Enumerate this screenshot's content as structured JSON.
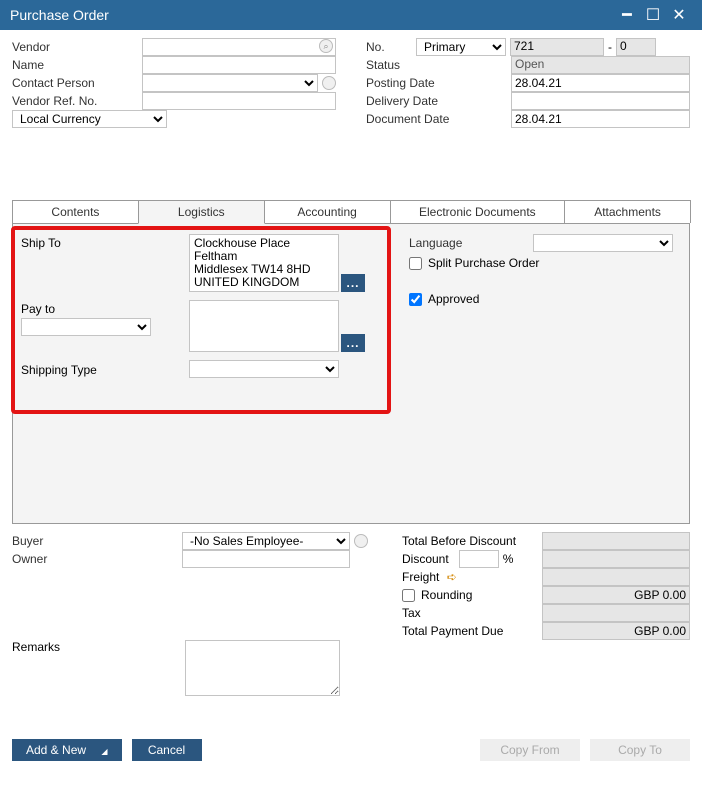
{
  "window": {
    "title": "Purchase Order"
  },
  "header": {
    "left": {
      "vendor_label": "Vendor",
      "vendor_value": "",
      "name_label": "Name",
      "name_value": "",
      "contact_label": "Contact Person",
      "contact_value": "",
      "vendorref_label": "Vendor Ref. No.",
      "vendorref_value": "",
      "currency_value": "Local Currency"
    },
    "right": {
      "no_label": "No.",
      "no_series": "Primary",
      "no_value": "721",
      "no_suffix": "0",
      "status_label": "Status",
      "status_value": "Open",
      "postingdate_label": "Posting Date",
      "postingdate_value": "28.04.21",
      "deliverydate_label": "Delivery Date",
      "deliverydate_value": "",
      "documentdate_label": "Document Date",
      "documentdate_value": "28.04.21"
    }
  },
  "tabs": {
    "contents": "Contents",
    "logistics": "Logistics",
    "accounting": "Accounting",
    "edocs": "Electronic Documents",
    "attachments": "Attachments"
  },
  "logistics": {
    "shipto_label": "Ship To",
    "shipto_line1": "Clockhouse Place",
    "shipto_line2": "Feltham",
    "shipto_line3": "Middlesex TW14 8HD",
    "shipto_line4": "UNITED KINGDOM",
    "payto_label": "Pay to",
    "payto_value": "",
    "shippingtype_label": "Shipping Type",
    "shippingtype_value": "",
    "language_label": "Language",
    "language_value": "",
    "split_label": "Split Purchase Order",
    "approved_label": "Approved",
    "ellipsis": "..."
  },
  "lower": {
    "buyer_label": "Buyer",
    "buyer_value": "-No Sales Employee-",
    "owner_label": "Owner",
    "owner_value": "",
    "remarks_label": "Remarks",
    "remarks_value": "",
    "tbd_label": "Total Before Discount",
    "tbd_value": "",
    "discount_label": "Discount",
    "discount_pct": "",
    "pct_sym": "%",
    "discount_value": "",
    "freight_label": "Freight",
    "freight_value": "",
    "rounding_label": "Rounding",
    "rounding_value": "GBP 0.00",
    "tax_label": "Tax",
    "tax_value": "",
    "total_label": "Total Payment Due",
    "total_value": "GBP 0.00"
  },
  "footer": {
    "addnew": "Add & New",
    "cancel": "Cancel",
    "copyfrom": "Copy From",
    "copyto": "Copy To"
  }
}
